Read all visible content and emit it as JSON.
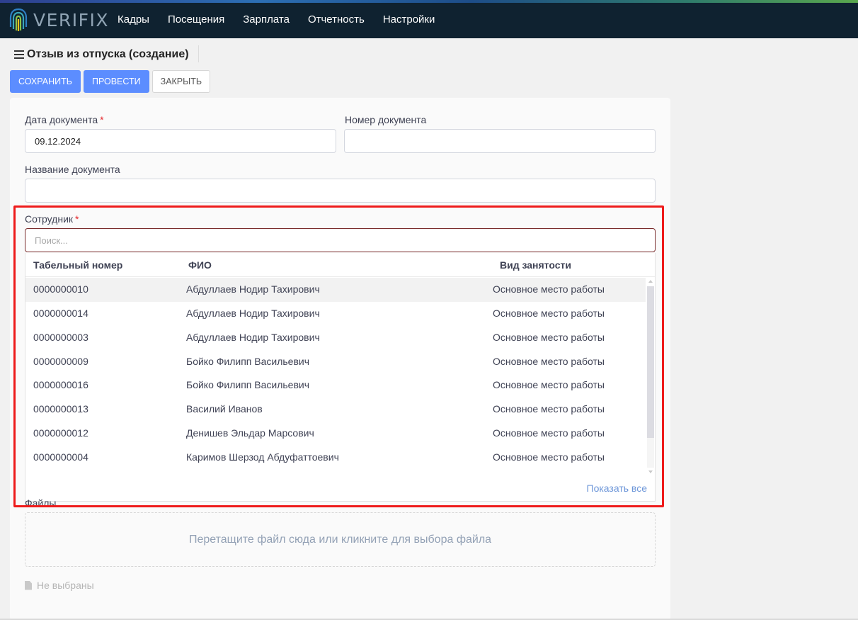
{
  "app": {
    "logo_text": "VERIFIX"
  },
  "nav": [
    "Кадры",
    "Посещения",
    "Зарплата",
    "Отчетность",
    "Настройки"
  ],
  "page": {
    "title": "Отзыв из отпуска (создание)"
  },
  "toolbar": {
    "save": "Сохранить",
    "post": "Провести",
    "close": "Закрыть"
  },
  "form": {
    "doc_date_label": "Дата документа",
    "doc_date_value": "09.12.2024",
    "doc_number_label": "Номер документа",
    "doc_number_value": "",
    "doc_name_label": "Название документа",
    "doc_name_value": "",
    "employee_label": "Сотрудник",
    "required_mark": "*",
    "search_placeholder": "Поиск..."
  },
  "employee_table": {
    "columns": [
      "Табельный номер",
      "ФИО",
      "Вид занятости"
    ],
    "rows": [
      [
        "0000000010",
        "Абдуллаев Нодир Тахирович",
        "Основное место работы"
      ],
      [
        "0000000014",
        "Абдуллаев Нодир Тахирович",
        "Основное место работы"
      ],
      [
        "0000000003",
        "Абдуллаев Нодир Тахирович",
        "Основное место работы"
      ],
      [
        "0000000009",
        "Бойко Филипп Васильевич",
        "Основное место работы"
      ],
      [
        "0000000016",
        "Бойко Филипп Васильевич",
        "Основное место работы"
      ],
      [
        "0000000013",
        "Василий Иванов",
        "Основное место работы"
      ],
      [
        "0000000012",
        "Денишев Эльдар Марсович",
        "Основное место работы"
      ],
      [
        "0000000004",
        "Каримов Шерзод Абдуфаттоевич",
        "Основное место работы"
      ]
    ],
    "show_all": "Показать все"
  },
  "files": {
    "label": "Файлы",
    "dropzone_text": "Перетащите файл сюда или кликните для выбора файла",
    "none_selected": "Не выбраны"
  },
  "colors": {
    "primary": "#5c8dff",
    "navbar": "#0f2230",
    "highlight": "#ee1b1b",
    "required": "#e5252a"
  }
}
